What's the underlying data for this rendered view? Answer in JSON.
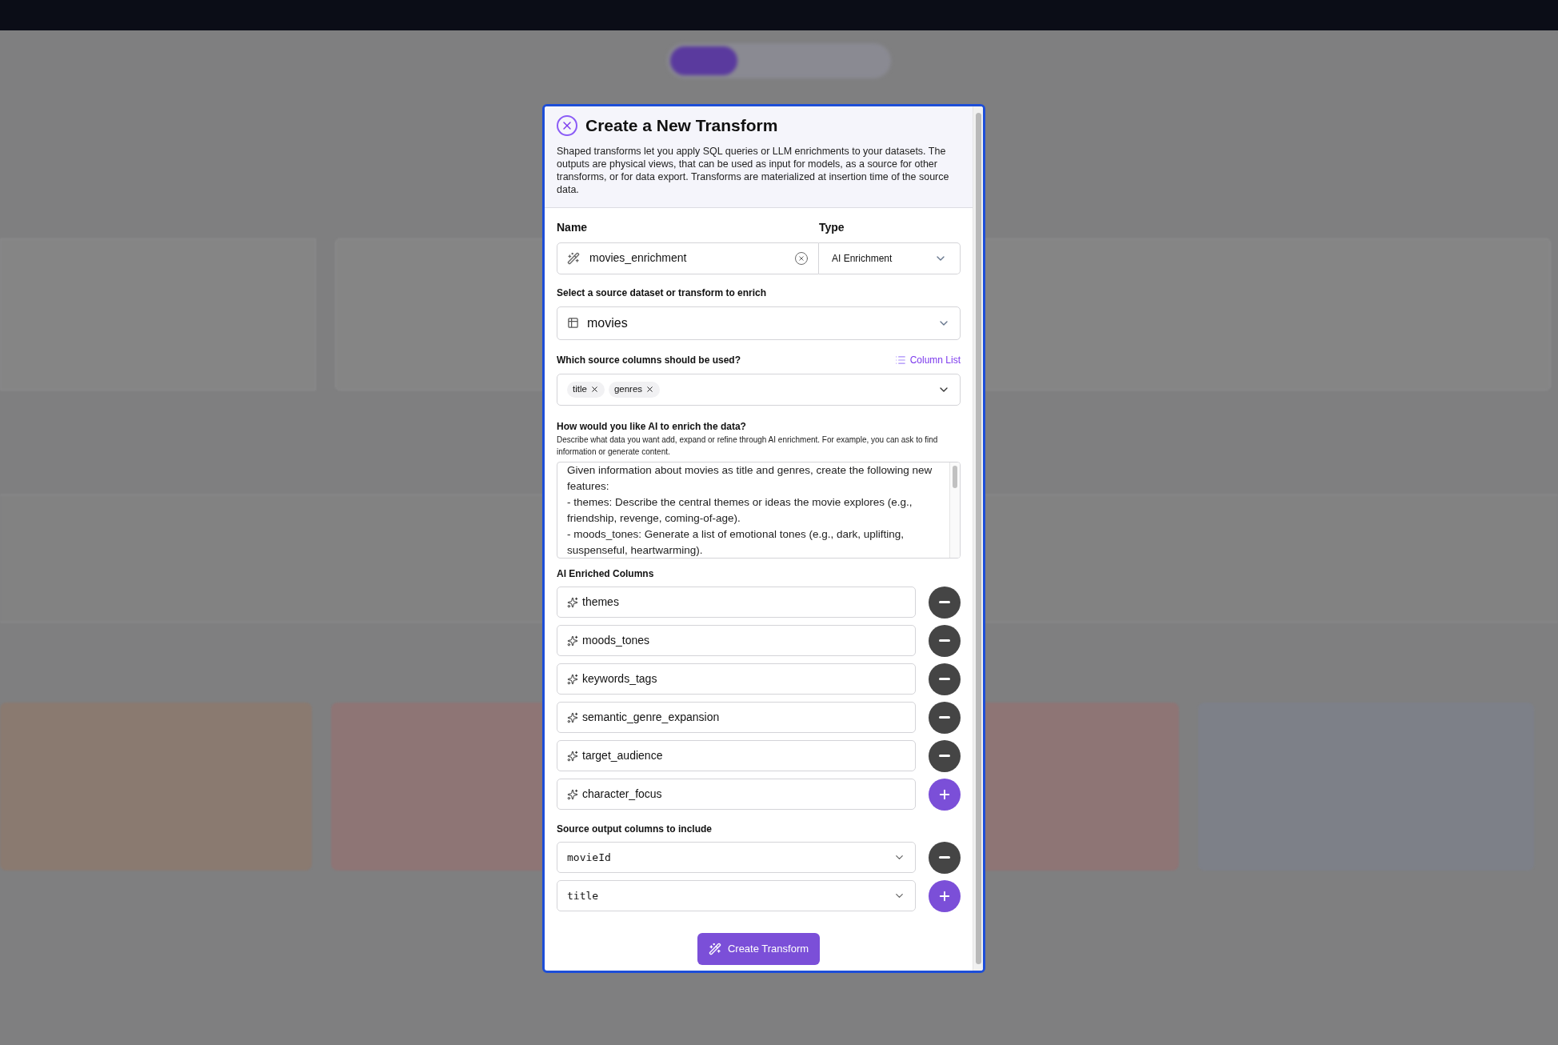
{
  "dialog": {
    "title": "Create a New Transform",
    "description": "Shaped transforms let you apply SQL queries or LLM enrichments to your datasets. The outputs are physical views, that can be used as input for models, as a source for other transforms, or for data export. Transforms are materialized at insertion time of the source data.",
    "name_field": {
      "label": "Name",
      "value": "movies_enrichment"
    },
    "type_field": {
      "label": "Type",
      "value": "AI Enrichment"
    },
    "source_field": {
      "label": "Select a source dataset or transform to enrich",
      "value": "movies"
    },
    "columns_field": {
      "label": "Which source columns should be used?",
      "link": "Column List",
      "tags": [
        "title",
        "genres"
      ]
    },
    "prompt_field": {
      "label": "How would you like AI to enrich the data?",
      "help": "Describe what data you want add, expand or refine through AI enrichment. For example, you can ask to find information or generate content.",
      "value": "Given information about movies as title and genres, create the following new features:\n- themes: Describe the central themes or ideas the movie explores (e.g., friendship, revenge, coming-of-age).\n- moods_tones: Generate a list of emotional tones (e.g., dark, uplifting, suspenseful, heartwarming)."
    },
    "enriched_columns": {
      "label": "AI Enriched Columns",
      "items": [
        {
          "value": "themes",
          "kind": "remove"
        },
        {
          "value": "moods_tones",
          "kind": "remove"
        },
        {
          "value": "keywords_tags",
          "kind": "remove"
        },
        {
          "value": "semantic_genre_expansion",
          "kind": "remove"
        },
        {
          "value": "target_audience",
          "kind": "remove"
        },
        {
          "value": "character_focus",
          "kind": "add"
        }
      ]
    },
    "output_columns": {
      "label": "Source output columns to include",
      "items": [
        {
          "value": "movieId",
          "kind": "remove"
        },
        {
          "value": "title",
          "kind": "add"
        }
      ]
    },
    "submit": "Create Transform"
  }
}
